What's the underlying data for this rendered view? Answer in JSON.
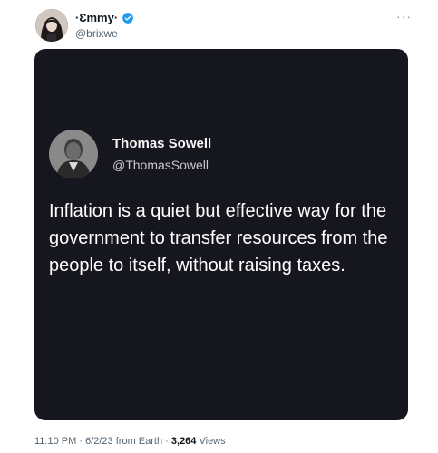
{
  "author": {
    "display_name": "·Ɛmmy·",
    "handle": "@brixwe",
    "more_label": "···"
  },
  "media": {
    "quote_author_name": "Thomas Sowell",
    "quote_author_handle": "@ThomasSowell",
    "quote_text": "Inflation is a quiet but effective way for the government to transfer resources from the people to itself, without raising taxes."
  },
  "meta": {
    "time": "11:10 PM",
    "separator": "·",
    "date": "6/2/23",
    "source": "from Earth",
    "views_count": "3,264",
    "views_label": "Views"
  },
  "colors": {
    "verified": "#1d9bf0",
    "card_background": "#16161f"
  }
}
